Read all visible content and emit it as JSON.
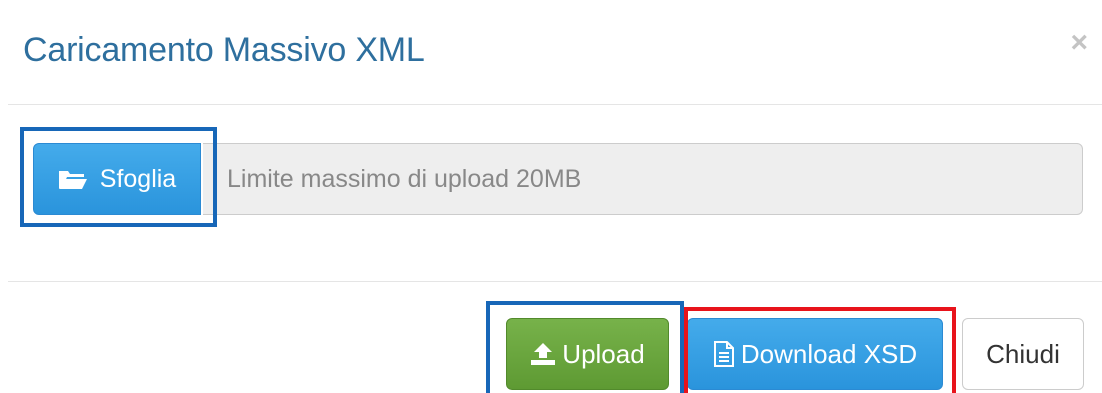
{
  "dialog": {
    "title": "Caricamento Massivo XML",
    "close_symbol": "×"
  },
  "file_picker": {
    "browse_label": "Sfoglia",
    "browse_icon": "folder-open-icon",
    "placeholder": "Limite massimo di upload 20MB"
  },
  "footer": {
    "upload_label": "Upload",
    "upload_icon": "upload-icon",
    "download_label": "Download XSD",
    "download_icon": "file-text-icon",
    "close_label": "Chiudi"
  },
  "colors": {
    "title": "#2e6f9e",
    "primary_button": "#2a94dc",
    "success_button": "#5e9a33",
    "highlight_blue": "#1767b8",
    "highlight_red": "#e8131b"
  }
}
